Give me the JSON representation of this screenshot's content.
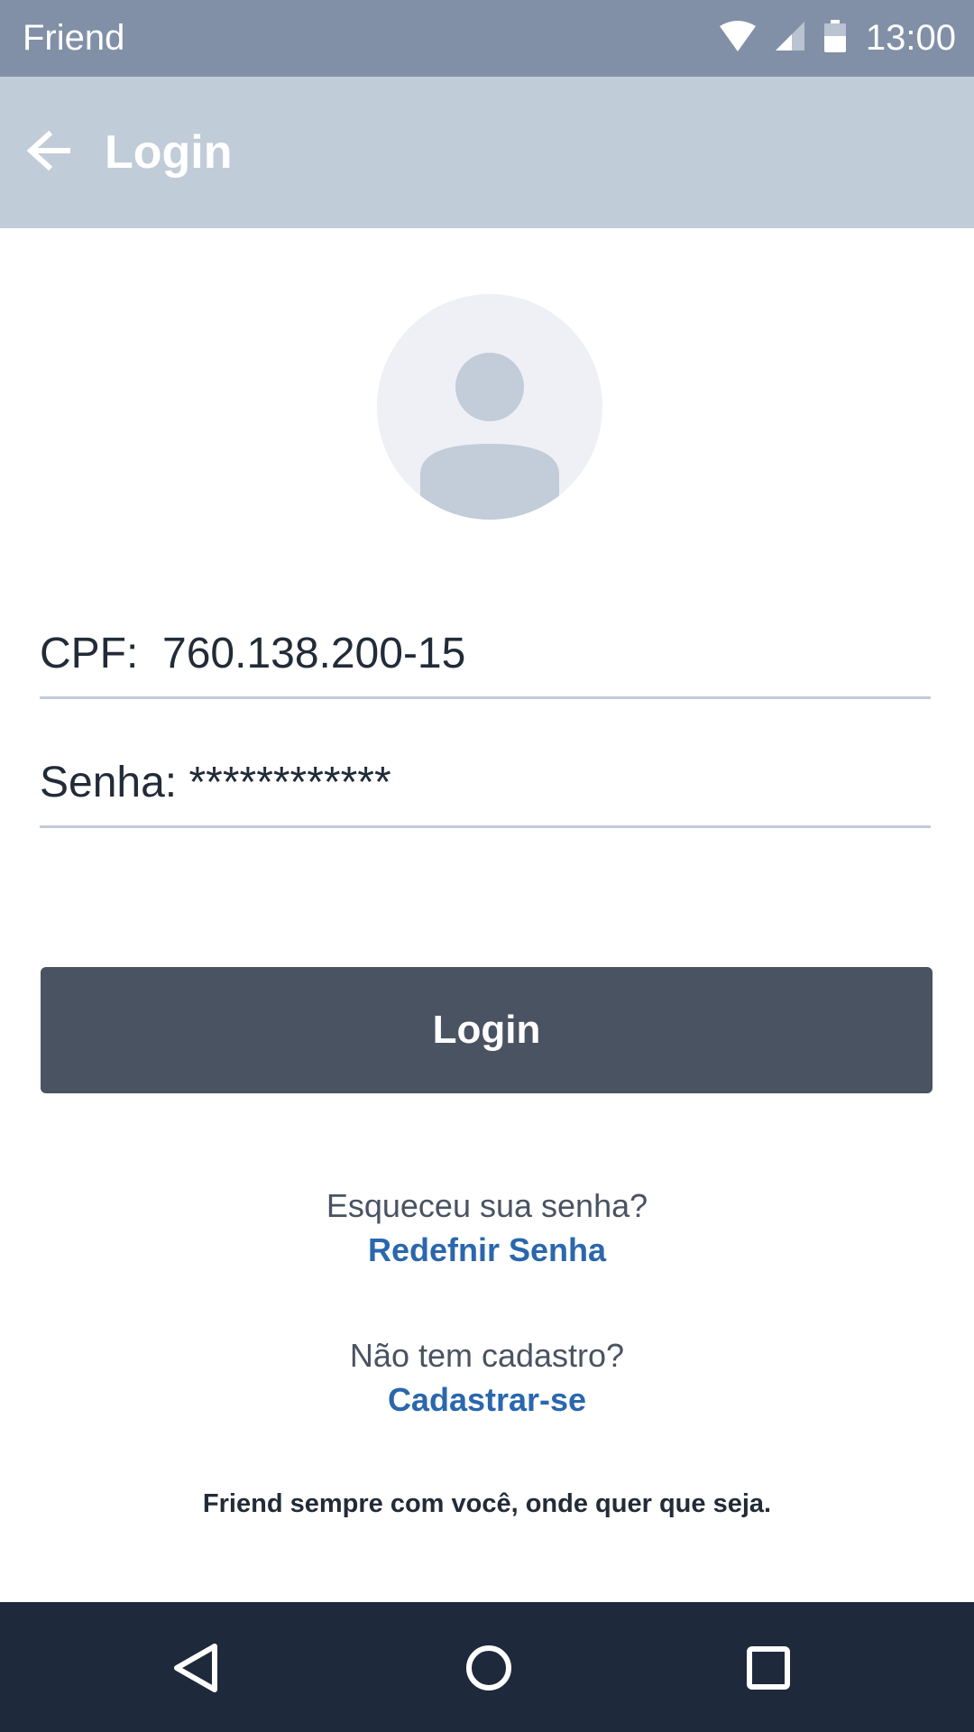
{
  "status_bar": {
    "app_name": "Friend",
    "time": "13:00"
  },
  "app_bar": {
    "title": "Login",
    "back_icon": "arrow-left-icon"
  },
  "form": {
    "cpf": {
      "label": "CPF:  ",
      "value": "760.138.200-15"
    },
    "senha": {
      "label": "Senha: ",
      "value": "************"
    },
    "login_label": "Login"
  },
  "forgot": {
    "question": "Esqueceu sua senha?",
    "link": "Redefnir Senha"
  },
  "signup": {
    "question": "Não tem cadastro?",
    "link": "Cadastrar-se"
  },
  "tagline": "Friend sempre com você, onde quer que seja.",
  "colors": {
    "status_bar": "#8190a6",
    "app_bar": "#c1ccd9",
    "button": "#4a5361",
    "link": "#2a67ad",
    "nav_bar": "#1e2a3b"
  }
}
